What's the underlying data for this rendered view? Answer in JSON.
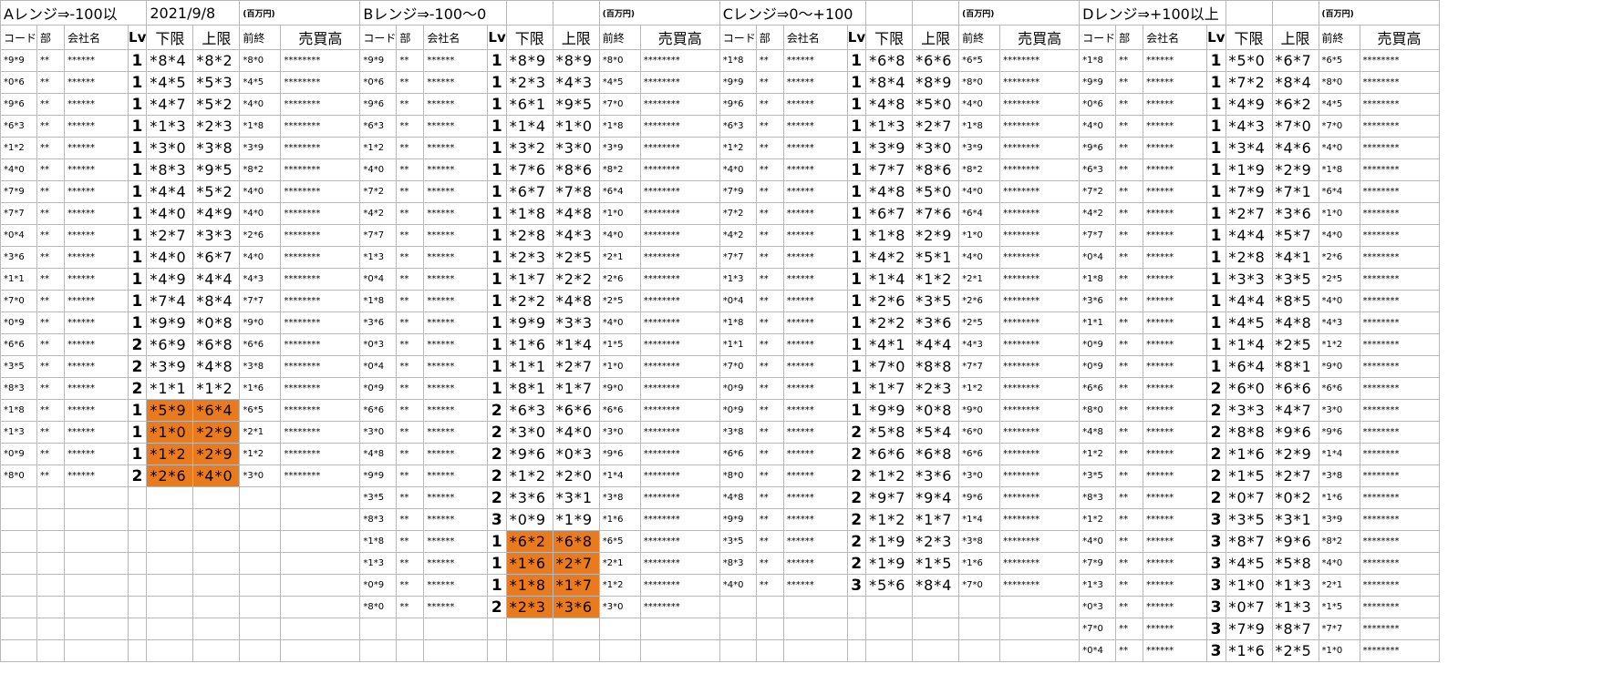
{
  "chart_data": {
    "type": "table",
    "sheet_date": "2021/9/8",
    "unit_note": "(百万円)",
    "column_headers": [
      "コード",
      "部",
      "会社名",
      "Lv",
      "下限",
      "上限",
      "前終",
      "売買高"
    ],
    "highlight_color": "#e97b1e",
    "lv_color": "#1f1fe6",
    "groups": [
      {
        "title": "Aレンジ⇒-100以",
        "rows": [
          [
            "*9*9",
            "**",
            "******",
            "1",
            "*8*4",
            "*8*2",
            "*8*0",
            "********"
          ],
          [
            "*0*6",
            "**",
            "******",
            "1",
            "*4*5",
            "*5*3",
            "*4*5",
            "********"
          ],
          [
            "*9*6",
            "**",
            "******",
            "1",
            "*4*7",
            "*5*2",
            "*4*0",
            "********"
          ],
          [
            "*6*3",
            "**",
            "******",
            "1",
            "*1*3",
            "*2*3",
            "*1*8",
            "********"
          ],
          [
            "*1*2",
            "**",
            "******",
            "1",
            "*3*0",
            "*3*8",
            "*3*9",
            "********"
          ],
          [
            "*4*0",
            "**",
            "******",
            "1",
            "*8*3",
            "*9*5",
            "*8*2",
            "********"
          ],
          [
            "*7*9",
            "**",
            "******",
            "1",
            "*4*4",
            "*5*2",
            "*4*0",
            "********"
          ],
          [
            "*7*7",
            "**",
            "******",
            "1",
            "*4*0",
            "*4*9",
            "*4*0",
            "********"
          ],
          [
            "*0*4",
            "**",
            "******",
            "1",
            "*2*7",
            "*3*3",
            "*2*6",
            "********"
          ],
          [
            "*3*6",
            "**",
            "******",
            "1",
            "*4*0",
            "*6*7",
            "*4*0",
            "********"
          ],
          [
            "*1*1",
            "**",
            "******",
            "1",
            "*4*9",
            "*4*4",
            "*4*3",
            "********"
          ],
          [
            "*7*0",
            "**",
            "******",
            "1",
            "*7*4",
            "*8*4",
            "*7*7",
            "********"
          ],
          [
            "*0*9",
            "**",
            "******",
            "1",
            "*9*9",
            "*0*8",
            "*9*0",
            "********"
          ],
          [
            "*6*6",
            "**",
            "******",
            "2",
            "*6*9",
            "*6*8",
            "*6*6",
            "********"
          ],
          [
            "*3*5",
            "**",
            "******",
            "2",
            "*3*9",
            "*4*8",
            "*3*8",
            "********"
          ],
          [
            "*8*3",
            "**",
            "******",
            "2",
            "*1*1",
            "*1*2",
            "*1*6",
            "********"
          ],
          [
            "*1*8",
            "**",
            "******",
            "1",
            "*5*9",
            "*6*4",
            "*6*5",
            "********"
          ],
          [
            "*1*3",
            "**",
            "******",
            "1",
            "*1*0",
            "*2*9",
            "*2*1",
            "********"
          ],
          [
            "*0*9",
            "**",
            "******",
            "1",
            "*1*2",
            "*2*9",
            "*1*2",
            "********"
          ],
          [
            "*8*0",
            "**",
            "******",
            "2",
            "*2*6",
            "*4*0",
            "*3*0",
            "********"
          ]
        ],
        "highlighted_rows": [
          16,
          17,
          18,
          19
        ]
      },
      {
        "title": "Bレンジ⇒-100～0",
        "rows": [
          [
            "*9*9",
            "**",
            "******",
            "1",
            "*8*9",
            "*8*9",
            "*8*0",
            "********"
          ],
          [
            "*0*6",
            "**",
            "******",
            "1",
            "*2*3",
            "*4*3",
            "*4*5",
            "********"
          ],
          [
            "*9*6",
            "**",
            "******",
            "1",
            "*6*1",
            "*9*5",
            "*7*0",
            "********"
          ],
          [
            "*6*3",
            "**",
            "******",
            "1",
            "*1*4",
            "*1*0",
            "*1*8",
            "********"
          ],
          [
            "*1*2",
            "**",
            "******",
            "1",
            "*3*2",
            "*3*0",
            "*3*9",
            "********"
          ],
          [
            "*4*0",
            "**",
            "******",
            "1",
            "*7*6",
            "*8*6",
            "*8*2",
            "********"
          ],
          [
            "*7*2",
            "**",
            "******",
            "1",
            "*6*7",
            "*7*8",
            "*6*4",
            "********"
          ],
          [
            "*4*2",
            "**",
            "******",
            "1",
            "*1*8",
            "*4*8",
            "*1*0",
            "********"
          ],
          [
            "*7*7",
            "**",
            "******",
            "1",
            "*2*8",
            "*4*3",
            "*4*0",
            "********"
          ],
          [
            "*1*3",
            "**",
            "******",
            "1",
            "*2*3",
            "*2*5",
            "*2*1",
            "********"
          ],
          [
            "*0*4",
            "**",
            "******",
            "1",
            "*1*7",
            "*2*2",
            "*2*6",
            "********"
          ],
          [
            "*1*8",
            "**",
            "******",
            "1",
            "*2*2",
            "*4*8",
            "*2*5",
            "********"
          ],
          [
            "*3*6",
            "**",
            "******",
            "1",
            "*9*9",
            "*3*3",
            "*4*0",
            "********"
          ],
          [
            "*0*3",
            "**",
            "******",
            "1",
            "*1*6",
            "*1*4",
            "*1*5",
            "********"
          ],
          [
            "*0*4",
            "**",
            "******",
            "1",
            "*1*1",
            "*2*7",
            "*1*0",
            "********"
          ],
          [
            "*0*9",
            "**",
            "******",
            "1",
            "*8*1",
            "*1*7",
            "*9*0",
            "********"
          ],
          [
            "*6*6",
            "**",
            "******",
            "2",
            "*6*3",
            "*6*6",
            "*6*6",
            "********"
          ],
          [
            "*3*0",
            "**",
            "******",
            "2",
            "*3*0",
            "*4*0",
            "*3*0",
            "********"
          ],
          [
            "*4*8",
            "**",
            "******",
            "2",
            "*9*6",
            "*0*3",
            "*9*6",
            "********"
          ],
          [
            "*9*9",
            "**",
            "******",
            "2",
            "*1*2",
            "*2*0",
            "*1*4",
            "********"
          ],
          [
            "*3*5",
            "**",
            "******",
            "2",
            "*3*6",
            "*3*1",
            "*3*8",
            "********"
          ],
          [
            "*8*3",
            "**",
            "******",
            "3",
            "*0*9",
            "*1*9",
            "*1*6",
            "********"
          ],
          [
            "*1*8",
            "**",
            "******",
            "1",
            "*6*2",
            "*6*8",
            "*6*5",
            "********"
          ],
          [
            "*1*3",
            "**",
            "******",
            "1",
            "*1*6",
            "*2*7",
            "*2*1",
            "********"
          ],
          [
            "*0*9",
            "**",
            "******",
            "1",
            "*1*8",
            "*1*7",
            "*1*2",
            "********"
          ],
          [
            "*8*0",
            "**",
            "******",
            "2",
            "*2*3",
            "*3*6",
            "*3*0",
            "********"
          ]
        ],
        "highlighted_rows": [
          22,
          23,
          24,
          25
        ]
      },
      {
        "title": "Cレンジ⇒0～+100",
        "rows": [
          [
            "*1*8",
            "**",
            "******",
            "1",
            "*6*8",
            "*6*6",
            "*6*5",
            "********"
          ],
          [
            "*9*9",
            "**",
            "******",
            "1",
            "*8*4",
            "*8*9",
            "*8*0",
            "********"
          ],
          [
            "*9*6",
            "**",
            "******",
            "1",
            "*4*8",
            "*5*0",
            "*4*0",
            "********"
          ],
          [
            "*6*3",
            "**",
            "******",
            "1",
            "*1*3",
            "*2*7",
            "*1*8",
            "********"
          ],
          [
            "*1*2",
            "**",
            "******",
            "1",
            "*3*9",
            "*3*0",
            "*3*9",
            "********"
          ],
          [
            "*4*0",
            "**",
            "******",
            "1",
            "*7*7",
            "*8*6",
            "*8*2",
            "********"
          ],
          [
            "*7*9",
            "**",
            "******",
            "1",
            "*4*8",
            "*5*0",
            "*4*0",
            "********"
          ],
          [
            "*7*2",
            "**",
            "******",
            "1",
            "*6*7",
            "*7*6",
            "*6*4",
            "********"
          ],
          [
            "*4*2",
            "**",
            "******",
            "1",
            "*1*8",
            "*2*9",
            "*1*0",
            "********"
          ],
          [
            "*7*7",
            "**",
            "******",
            "1",
            "*4*2",
            "*5*1",
            "*4*0",
            "********"
          ],
          [
            "*1*3",
            "**",
            "******",
            "1",
            "*1*4",
            "*1*2",
            "*2*1",
            "********"
          ],
          [
            "*0*4",
            "**",
            "******",
            "1",
            "*2*6",
            "*3*5",
            "*2*6",
            "********"
          ],
          [
            "*1*8",
            "**",
            "******",
            "1",
            "*2*2",
            "*3*6",
            "*2*5",
            "********"
          ],
          [
            "*1*1",
            "**",
            "******",
            "1",
            "*4*1",
            "*4*4",
            "*4*3",
            "********"
          ],
          [
            "*7*0",
            "**",
            "******",
            "1",
            "*7*0",
            "*8*8",
            "*7*7",
            "********"
          ],
          [
            "*0*9",
            "**",
            "******",
            "1",
            "*1*7",
            "*2*3",
            "*1*2",
            "********"
          ],
          [
            "*0*9",
            "**",
            "******",
            "1",
            "*9*9",
            "*0*8",
            "*9*0",
            "********"
          ],
          [
            "*3*8",
            "**",
            "******",
            "2",
            "*5*8",
            "*5*4",
            "*6*0",
            "********"
          ],
          [
            "*6*6",
            "**",
            "******",
            "2",
            "*6*6",
            "*6*8",
            "*6*6",
            "********"
          ],
          [
            "*8*0",
            "**",
            "******",
            "2",
            "*1*2",
            "*3*6",
            "*3*0",
            "********"
          ],
          [
            "*4*8",
            "**",
            "******",
            "2",
            "*9*7",
            "*9*4",
            "*9*6",
            "********"
          ],
          [
            "*9*9",
            "**",
            "******",
            "2",
            "*1*2",
            "*1*7",
            "*1*4",
            "********"
          ],
          [
            "*3*5",
            "**",
            "******",
            "2",
            "*1*9",
            "*2*3",
            "*3*8",
            "********"
          ],
          [
            "*8*3",
            "**",
            "******",
            "2",
            "*1*9",
            "*1*5",
            "*1*6",
            "********"
          ],
          [
            "*4*0",
            "**",
            "******",
            "3",
            "*5*6",
            "*8*4",
            "*7*0",
            "********"
          ]
        ],
        "highlighted_rows": []
      },
      {
        "title": "Dレンジ⇒+100以上",
        "rows": [
          [
            "*1*8",
            "**",
            "******",
            "1",
            "*5*0",
            "*6*7",
            "*6*5",
            "********"
          ],
          [
            "*9*9",
            "**",
            "******",
            "1",
            "*7*2",
            "*8*4",
            "*8*0",
            "********"
          ],
          [
            "*0*6",
            "**",
            "******",
            "1",
            "*4*9",
            "*6*2",
            "*4*5",
            "********"
          ],
          [
            "*4*0",
            "**",
            "******",
            "1",
            "*4*3",
            "*7*0",
            "*7*0",
            "********"
          ],
          [
            "*9*6",
            "**",
            "******",
            "1",
            "*3*4",
            "*4*6",
            "*4*0",
            "********"
          ],
          [
            "*6*3",
            "**",
            "******",
            "1",
            "*1*9",
            "*2*9",
            "*1*8",
            "********"
          ],
          [
            "*7*2",
            "**",
            "******",
            "1",
            "*7*9",
            "*7*1",
            "*6*4",
            "********"
          ],
          [
            "*4*2",
            "**",
            "******",
            "1",
            "*2*7",
            "*3*6",
            "*1*0",
            "********"
          ],
          [
            "*7*7",
            "**",
            "******",
            "1",
            "*4*4",
            "*5*7",
            "*4*0",
            "********"
          ],
          [
            "*0*4",
            "**",
            "******",
            "1",
            "*2*8",
            "*4*1",
            "*2*6",
            "********"
          ],
          [
            "*1*8",
            "**",
            "******",
            "1",
            "*3*3",
            "*3*5",
            "*2*5",
            "********"
          ],
          [
            "*3*6",
            "**",
            "******",
            "1",
            "*4*4",
            "*8*5",
            "*4*0",
            "********"
          ],
          [
            "*1*1",
            "**",
            "******",
            "1",
            "*4*5",
            "*4*8",
            "*4*3",
            "********"
          ],
          [
            "*0*9",
            "**",
            "******",
            "1",
            "*1*4",
            "*2*5",
            "*1*2",
            "********"
          ],
          [
            "*0*9",
            "**",
            "******",
            "1",
            "*6*4",
            "*8*1",
            "*9*0",
            "********"
          ],
          [
            "*6*6",
            "**",
            "******",
            "2",
            "*6*0",
            "*6*6",
            "*6*6",
            "********"
          ],
          [
            "*8*0",
            "**",
            "******",
            "2",
            "*3*3",
            "*4*7",
            "*3*0",
            "********"
          ],
          [
            "*4*8",
            "**",
            "******",
            "2",
            "*8*8",
            "*9*6",
            "*9*6",
            "********"
          ],
          [
            "*1*2",
            "**",
            "******",
            "2",
            "*1*6",
            "*2*9",
            "*1*4",
            "********"
          ],
          [
            "*3*5",
            "**",
            "******",
            "2",
            "*1*5",
            "*2*7",
            "*3*8",
            "********"
          ],
          [
            "*8*3",
            "**",
            "******",
            "2",
            "*0*7",
            "*0*2",
            "*1*6",
            "********"
          ],
          [
            "*1*2",
            "**",
            "******",
            "3",
            "*3*5",
            "*3*1",
            "*3*9",
            "********"
          ],
          [
            "*4*0",
            "**",
            "******",
            "3",
            "*8*7",
            "*9*6",
            "*8*2",
            "********"
          ],
          [
            "*7*9",
            "**",
            "******",
            "3",
            "*4*5",
            "*5*8",
            "*4*0",
            "********"
          ],
          [
            "*1*3",
            "**",
            "******",
            "3",
            "*1*0",
            "*1*3",
            "*2*1",
            "********"
          ],
          [
            "*0*3",
            "**",
            "******",
            "3",
            "*0*7",
            "*1*3",
            "*1*5",
            "********"
          ],
          [
            "*7*0",
            "**",
            "******",
            "3",
            "*7*9",
            "*8*7",
            "*7*7",
            "********"
          ],
          [
            "*0*4",
            "**",
            "******",
            "3",
            "*1*6",
            "*2*5",
            "*1*0",
            "********"
          ]
        ],
        "highlighted_rows": []
      }
    ]
  }
}
